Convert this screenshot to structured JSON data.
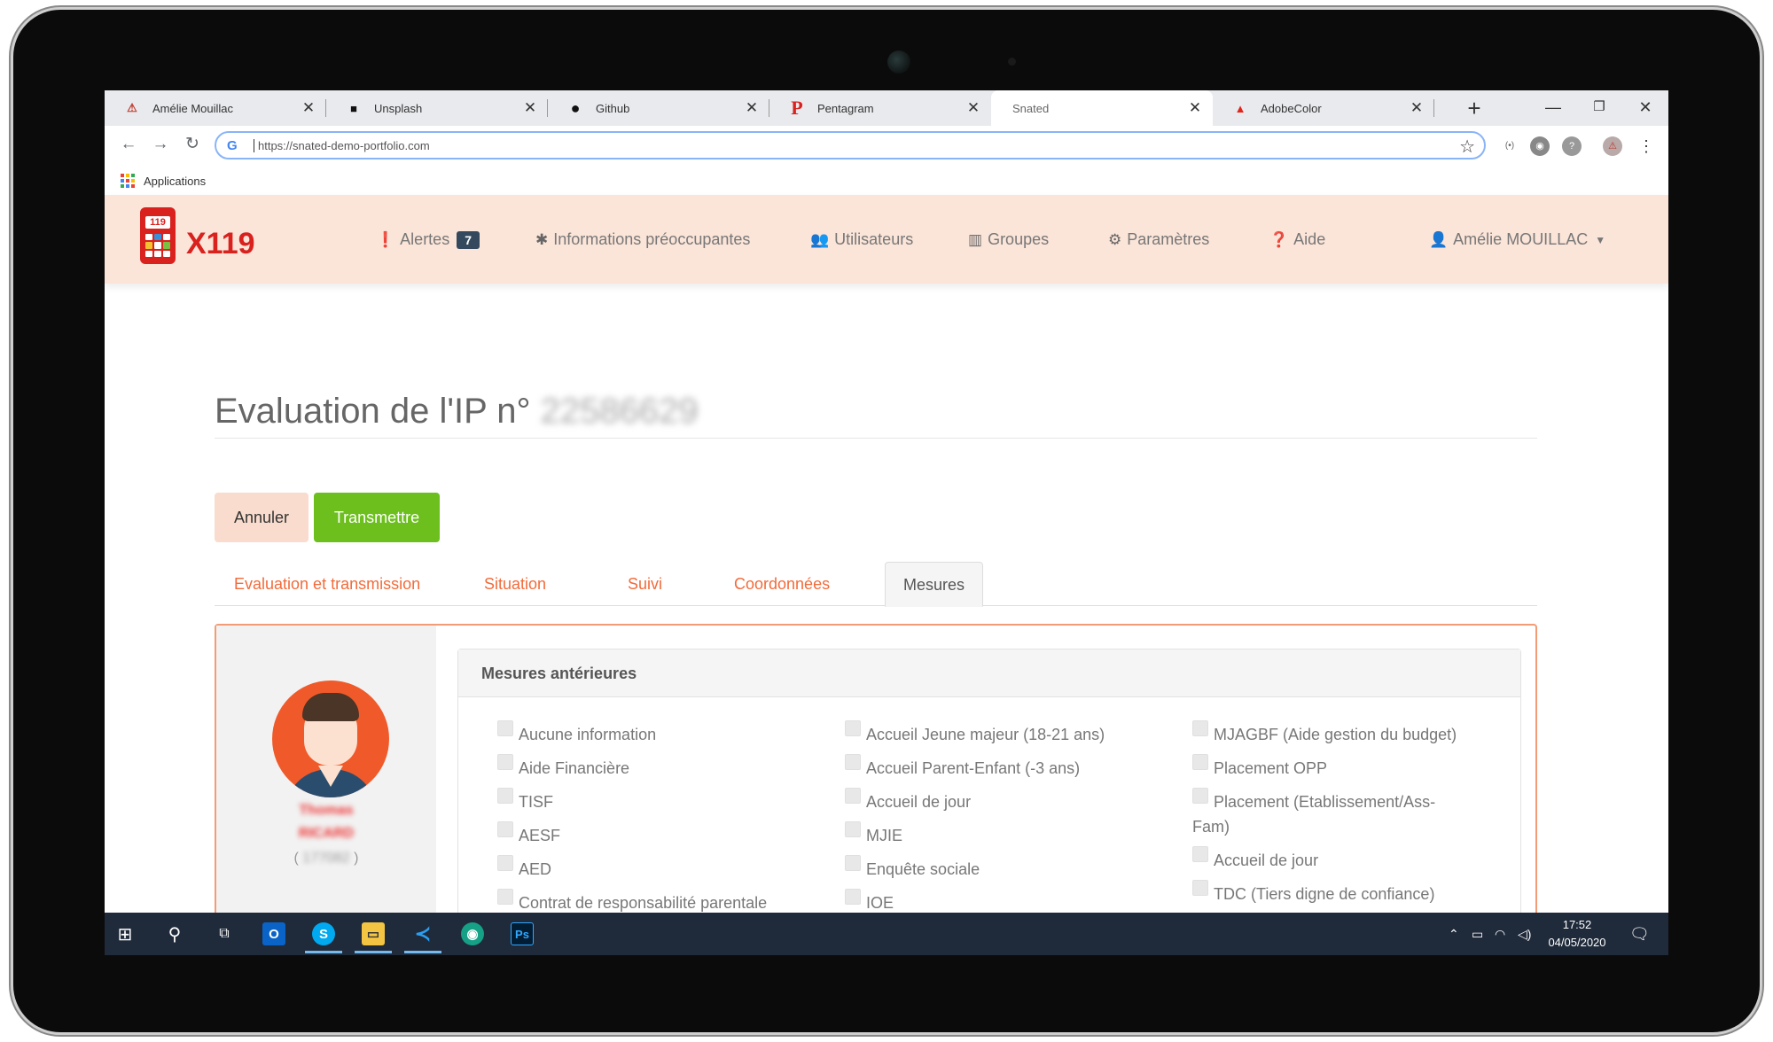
{
  "browser": {
    "tabs": [
      {
        "title": "Amélie Mouillac",
        "icon": "adobe-a-icon",
        "color": "#c0392b"
      },
      {
        "title": "Unsplash",
        "icon": "unsplash-icon",
        "color": "#111111"
      },
      {
        "title": "Github",
        "icon": "github-icon",
        "color": "#111111"
      },
      {
        "title": "Pentagram",
        "icon": "pentagram-p-icon",
        "color": "#d9211e"
      },
      {
        "title": "Snated",
        "icon": "",
        "color": ""
      },
      {
        "title": "AdobeColor",
        "icon": "adobe-icon",
        "color": "#e3241b"
      }
    ],
    "active_tab": 4,
    "url": "https://snated-demo-portfolio.com",
    "bookmark_apps_label": "Applications"
  },
  "app": {
    "logo_text": "X119",
    "logo_screen": "119",
    "nav": {
      "alerts_label": "Alertes",
      "alerts_count": "7",
      "informations_label": "Informations préoccupantes",
      "users_label": "Utilisateurs",
      "groups_label": "Groupes",
      "settings_label": "Paramètres",
      "help_label": "Aide",
      "user_label": "Amélie MOUILLAC"
    },
    "page_title": "Evaluation de l'IP n°",
    "page_title_number": "22586629",
    "buttons": {
      "cancel": "Annuler",
      "send": "Transmettre"
    },
    "tabs": [
      "Evaluation et transmission",
      "Situation",
      "Suivi",
      "Coordonnées",
      "Mesures"
    ],
    "active_tab": "Mesures",
    "person": {
      "first_name": "Thomas",
      "last_name": "RICARD",
      "id_prefix": "(",
      "id": "177082",
      "id_suffix": ")"
    },
    "mesures": {
      "title": "Mesures antérieures",
      "col1": [
        "Aucune information",
        "Aide Financière",
        "TISF",
        "AESF",
        "AED",
        "Contrat de responsabilité parentale"
      ],
      "col2": [
        "Accueil Jeune majeur (18-21 ans)",
        "Accueil Parent-Enfant (-3 ans)",
        "Accueil de jour",
        "MJIE",
        "Enquête sociale",
        "IOE"
      ],
      "col3": [
        "MJAGBF (Aide gestion du budget)",
        "Placement OPP",
        "Placement (Etablissement/Ass-Fam)",
        "Accueil de jour",
        "TDC (Tiers digne de confiance)"
      ]
    }
  },
  "taskbar": {
    "time": "17:52",
    "date": "04/05/2020"
  },
  "colors": {
    "accent": "#f26b3a",
    "nav_bg": "#fbe4d8",
    "send_button": "#6cbf1d",
    "logo_red": "#d9211e"
  }
}
